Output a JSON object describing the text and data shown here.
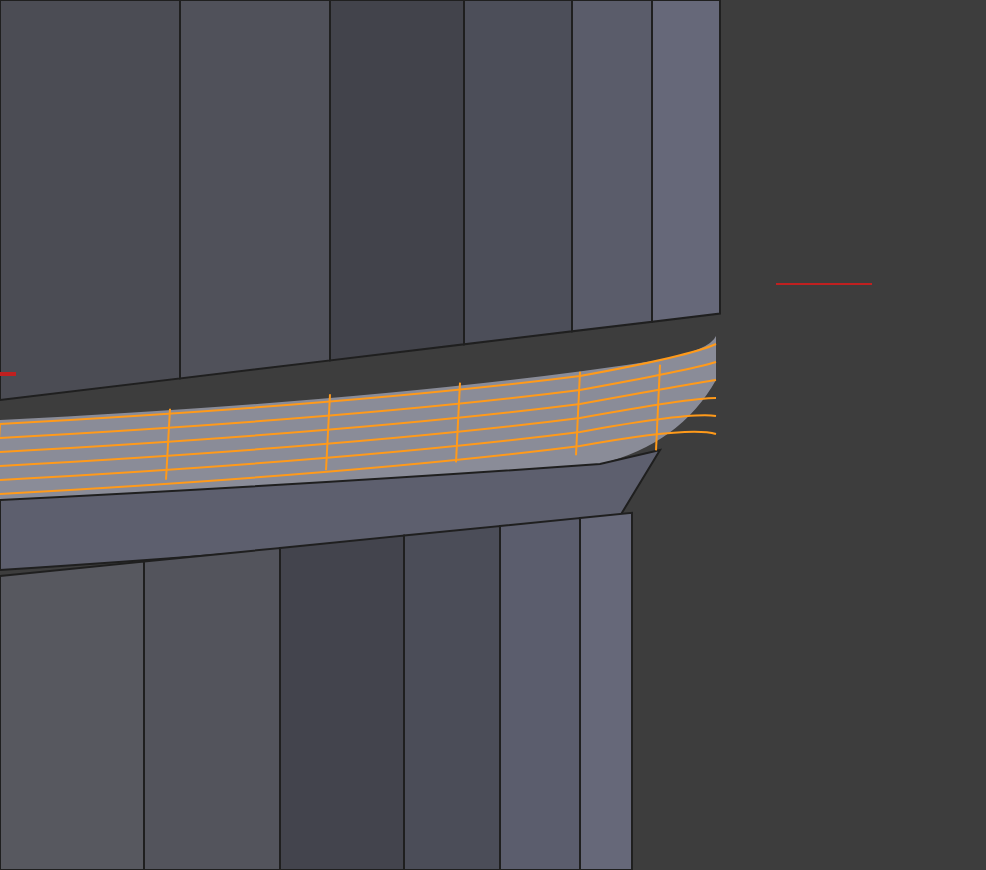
{
  "viewport": {
    "kind": "mesh"
  }
}
